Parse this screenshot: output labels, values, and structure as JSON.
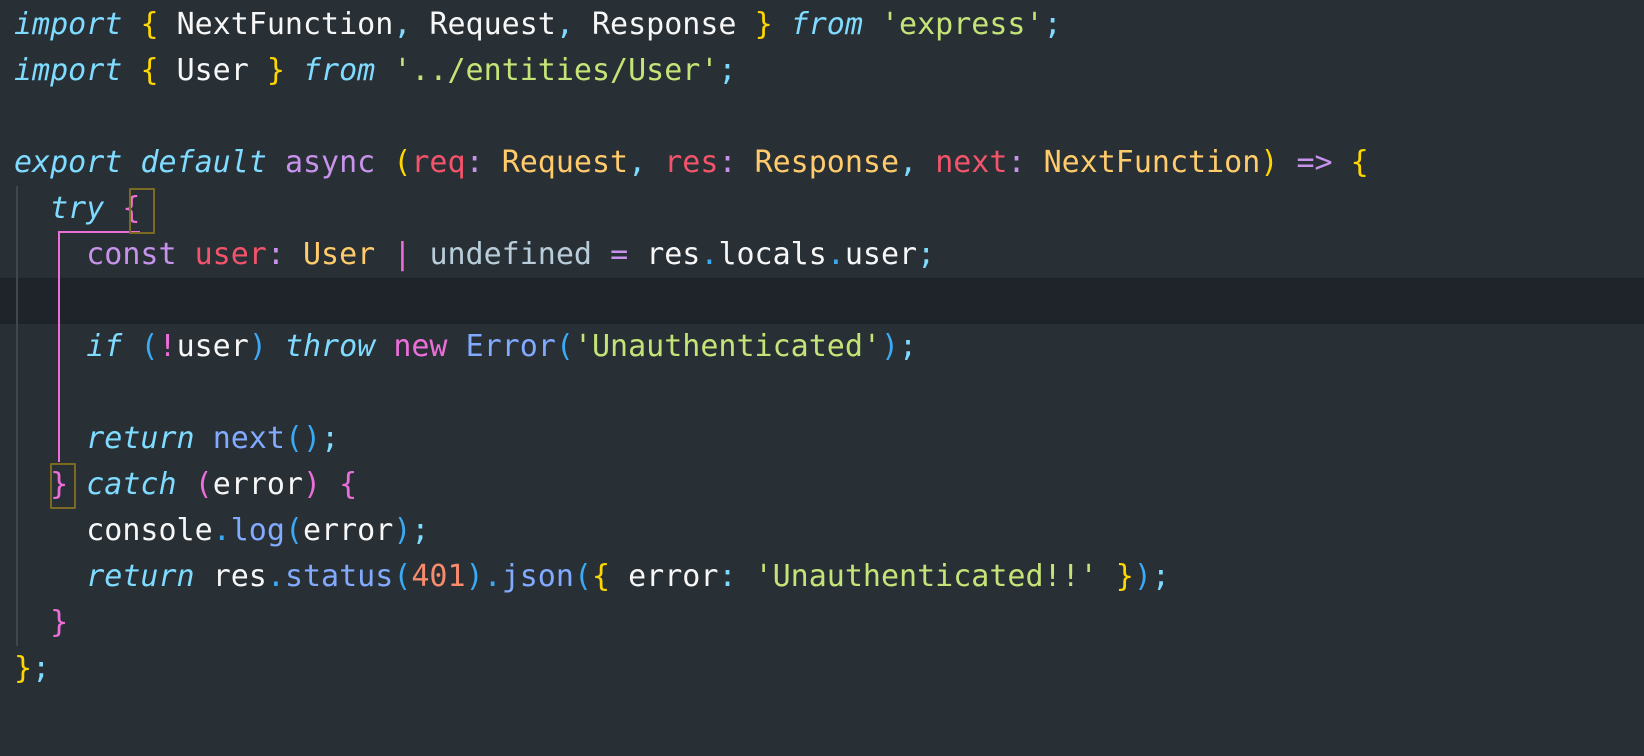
{
  "editor": {
    "language": "typescript",
    "background_color": "#282f35",
    "active_line_color": "#1e242a",
    "indent_guide_color": "#3d4852",
    "active_indent_guide_color": "#ec6fd9",
    "bracket_match_border_color": "#7a6a22",
    "font_size_px": 30,
    "line_height_px": 46,
    "active_line_number": 6
  },
  "palette": {
    "keyword": "#7fdbff",
    "storage": "#c792ea",
    "brace_yellow": "#ffd700",
    "punctuation_cyan": "#7fdbff",
    "identifier": "#f7f7f7",
    "string": "#c5e478",
    "type": "#ffcb6b",
    "parameter": "#f4546b",
    "operator": "#c792ea",
    "undefined_value": "#b8cdd9",
    "dot": "#3ba9f4",
    "function": "#82aaff",
    "blue_paren": "#3ba9f4",
    "pink_paren": "#ec6fd9",
    "number": "#f78c6c"
  },
  "lines": [
    {
      "n": 1,
      "text": "import { NextFunction, Request, Response } from 'express';",
      "tokens": [
        {
          "t": "import",
          "c": "kw"
        },
        {
          "t": " ",
          "c": "plain"
        },
        {
          "t": "{",
          "c": "curly"
        },
        {
          "t": " ",
          "c": "plain"
        },
        {
          "t": "NextFunction",
          "c": "plain"
        },
        {
          "t": ",",
          "c": "punct"
        },
        {
          "t": " ",
          "c": "plain"
        },
        {
          "t": "Request",
          "c": "plain"
        },
        {
          "t": ",",
          "c": "punct"
        },
        {
          "t": " ",
          "c": "plain"
        },
        {
          "t": "Response",
          "c": "plain"
        },
        {
          "t": " ",
          "c": "plain"
        },
        {
          "t": "}",
          "c": "curly"
        },
        {
          "t": " ",
          "c": "plain"
        },
        {
          "t": "from",
          "c": "kw"
        },
        {
          "t": " ",
          "c": "plain"
        },
        {
          "t": "'express'",
          "c": "str"
        },
        {
          "t": ";",
          "c": "punct"
        }
      ]
    },
    {
      "n": 2,
      "text": "import { User } from '../entities/User';",
      "tokens": [
        {
          "t": "import",
          "c": "kw"
        },
        {
          "t": " ",
          "c": "plain"
        },
        {
          "t": "{",
          "c": "curly"
        },
        {
          "t": " ",
          "c": "plain"
        },
        {
          "t": "User",
          "c": "plain"
        },
        {
          "t": " ",
          "c": "plain"
        },
        {
          "t": "}",
          "c": "curly"
        },
        {
          "t": " ",
          "c": "plain"
        },
        {
          "t": "from",
          "c": "kw"
        },
        {
          "t": " ",
          "c": "plain"
        },
        {
          "t": "'../entities/User'",
          "c": "str"
        },
        {
          "t": ";",
          "c": "punct"
        }
      ]
    },
    {
      "n": 3,
      "text": "",
      "tokens": []
    },
    {
      "n": 4,
      "text": "export default async (req: Request, res: Response, next: NextFunction) => {",
      "tokens": [
        {
          "t": "export",
          "c": "kw"
        },
        {
          "t": " ",
          "c": "plain"
        },
        {
          "t": "default",
          "c": "kw"
        },
        {
          "t": " ",
          "c": "plain"
        },
        {
          "t": "async",
          "c": "storage"
        },
        {
          "t": " ",
          "c": "plain"
        },
        {
          "t": "(",
          "c": "paren"
        },
        {
          "t": "req",
          "c": "param"
        },
        {
          "t": ":",
          "c": "colon"
        },
        {
          "t": " ",
          "c": "plain"
        },
        {
          "t": "Request",
          "c": "type"
        },
        {
          "t": ",",
          "c": "punct"
        },
        {
          "t": " ",
          "c": "plain"
        },
        {
          "t": "res",
          "c": "param"
        },
        {
          "t": ":",
          "c": "colon"
        },
        {
          "t": " ",
          "c": "plain"
        },
        {
          "t": "Response",
          "c": "type"
        },
        {
          "t": ",",
          "c": "punct"
        },
        {
          "t": " ",
          "c": "plain"
        },
        {
          "t": "next",
          "c": "param"
        },
        {
          "t": ":",
          "c": "colon"
        },
        {
          "t": " ",
          "c": "plain"
        },
        {
          "t": "NextFunction",
          "c": "type"
        },
        {
          "t": ")",
          "c": "paren"
        },
        {
          "t": " ",
          "c": "plain"
        },
        {
          "t": "=>",
          "c": "op"
        },
        {
          "t": " ",
          "c": "plain"
        },
        {
          "t": "{",
          "c": "curly"
        }
      ]
    },
    {
      "n": 5,
      "text": "  try {",
      "tokens": [
        {
          "t": "  ",
          "c": "plain"
        },
        {
          "t": "try",
          "c": "kw"
        },
        {
          "t": " ",
          "c": "plain"
        },
        {
          "t": "{",
          "c": "brace-p"
        }
      ]
    },
    {
      "n": 6,
      "text": "    const user: User | undefined = res.locals.user;",
      "tokens": [
        {
          "t": "    ",
          "c": "plain"
        },
        {
          "t": "const",
          "c": "storage"
        },
        {
          "t": " ",
          "c": "plain"
        },
        {
          "t": "user",
          "c": "param"
        },
        {
          "t": ":",
          "c": "colon"
        },
        {
          "t": " ",
          "c": "plain"
        },
        {
          "t": "User",
          "c": "type"
        },
        {
          "t": " ",
          "c": "plain"
        },
        {
          "t": "|",
          "c": "pipe"
        },
        {
          "t": " ",
          "c": "plain"
        },
        {
          "t": "undefined",
          "c": "undef"
        },
        {
          "t": " ",
          "c": "plain"
        },
        {
          "t": "=",
          "c": "op"
        },
        {
          "t": " ",
          "c": "plain"
        },
        {
          "t": "res",
          "c": "plain"
        },
        {
          "t": ".",
          "c": "dot"
        },
        {
          "t": "locals",
          "c": "plain"
        },
        {
          "t": ".",
          "c": "dot"
        },
        {
          "t": "user",
          "c": "plain"
        },
        {
          "t": ";",
          "c": "punct"
        }
      ]
    },
    {
      "n": 7,
      "text": "",
      "tokens": [],
      "active": true
    },
    {
      "n": 8,
      "text": "    if (!user) throw new Error('Unauthenticated');",
      "tokens": [
        {
          "t": "    ",
          "c": "plain"
        },
        {
          "t": "if",
          "c": "kw"
        },
        {
          "t": " ",
          "c": "plain"
        },
        {
          "t": "(",
          "c": "bparen"
        },
        {
          "t": "!",
          "c": "pparen"
        },
        {
          "t": "user",
          "c": "plain"
        },
        {
          "t": ")",
          "c": "bparen"
        },
        {
          "t": " ",
          "c": "plain"
        },
        {
          "t": "throw",
          "c": "kw"
        },
        {
          "t": " ",
          "c": "plain"
        },
        {
          "t": "new",
          "c": "brace-p"
        },
        {
          "t": " ",
          "c": "plain"
        },
        {
          "t": "Error",
          "c": "fn"
        },
        {
          "t": "(",
          "c": "bparen"
        },
        {
          "t": "'Unauthenticated'",
          "c": "str"
        },
        {
          "t": ")",
          "c": "bparen"
        },
        {
          "t": ";",
          "c": "punct"
        }
      ]
    },
    {
      "n": 9,
      "text": "",
      "tokens": []
    },
    {
      "n": 10,
      "text": "    return next();",
      "tokens": [
        {
          "t": "    ",
          "c": "plain"
        },
        {
          "t": "return",
          "c": "kw"
        },
        {
          "t": " ",
          "c": "plain"
        },
        {
          "t": "next",
          "c": "fn"
        },
        {
          "t": "(",
          "c": "bparen"
        },
        {
          "t": ")",
          "c": "bparen"
        },
        {
          "t": ";",
          "c": "punct"
        }
      ]
    },
    {
      "n": 11,
      "text": "  } catch (error) {",
      "tokens": [
        {
          "t": "  ",
          "c": "plain"
        },
        {
          "t": "}",
          "c": "brace-p"
        },
        {
          "t": " ",
          "c": "plain"
        },
        {
          "t": "catch",
          "c": "kw"
        },
        {
          "t": " ",
          "c": "plain"
        },
        {
          "t": "(",
          "c": "pparen"
        },
        {
          "t": "error",
          "c": "plain"
        },
        {
          "t": ")",
          "c": "pparen"
        },
        {
          "t": " ",
          "c": "plain"
        },
        {
          "t": "{",
          "c": "pparen"
        }
      ]
    },
    {
      "n": 12,
      "text": "    console.log(error);",
      "tokens": [
        {
          "t": "    ",
          "c": "plain"
        },
        {
          "t": "console",
          "c": "plain"
        },
        {
          "t": ".",
          "c": "dot"
        },
        {
          "t": "log",
          "c": "fn"
        },
        {
          "t": "(",
          "c": "bparen"
        },
        {
          "t": "error",
          "c": "plain"
        },
        {
          "t": ")",
          "c": "bparen"
        },
        {
          "t": ";",
          "c": "punct"
        }
      ]
    },
    {
      "n": 13,
      "text": "    return res.status(401).json({ error: 'Unauthenticated!!' });",
      "tokens": [
        {
          "t": "    ",
          "c": "plain"
        },
        {
          "t": "return",
          "c": "kw"
        },
        {
          "t": " ",
          "c": "plain"
        },
        {
          "t": "res",
          "c": "plain"
        },
        {
          "t": ".",
          "c": "dot"
        },
        {
          "t": "status",
          "c": "fn"
        },
        {
          "t": "(",
          "c": "bparen"
        },
        {
          "t": "401",
          "c": "num"
        },
        {
          "t": ")",
          "c": "bparen"
        },
        {
          "t": ".",
          "c": "dot"
        },
        {
          "t": "json",
          "c": "fn"
        },
        {
          "t": "(",
          "c": "bparen"
        },
        {
          "t": "{",
          "c": "curly"
        },
        {
          "t": " ",
          "c": "plain"
        },
        {
          "t": "error",
          "c": "plain"
        },
        {
          "t": ":",
          "c": "punct"
        },
        {
          "t": " ",
          "c": "plain"
        },
        {
          "t": "'Unauthenticated!!'",
          "c": "str"
        },
        {
          "t": " ",
          "c": "plain"
        },
        {
          "t": "}",
          "c": "curly"
        },
        {
          "t": ")",
          "c": "bparen"
        },
        {
          "t": ";",
          "c": "punct"
        }
      ]
    },
    {
      "n": 14,
      "text": "  }",
      "tokens": [
        {
          "t": "  ",
          "c": "plain"
        },
        {
          "t": "}",
          "c": "pparen"
        }
      ]
    },
    {
      "n": 15,
      "text": "};",
      "tokens": [
        {
          "t": "}",
          "c": "curly"
        },
        {
          "t": ";",
          "c": "punct"
        }
      ]
    },
    {
      "n": 16,
      "text": "",
      "tokens": []
    }
  ]
}
